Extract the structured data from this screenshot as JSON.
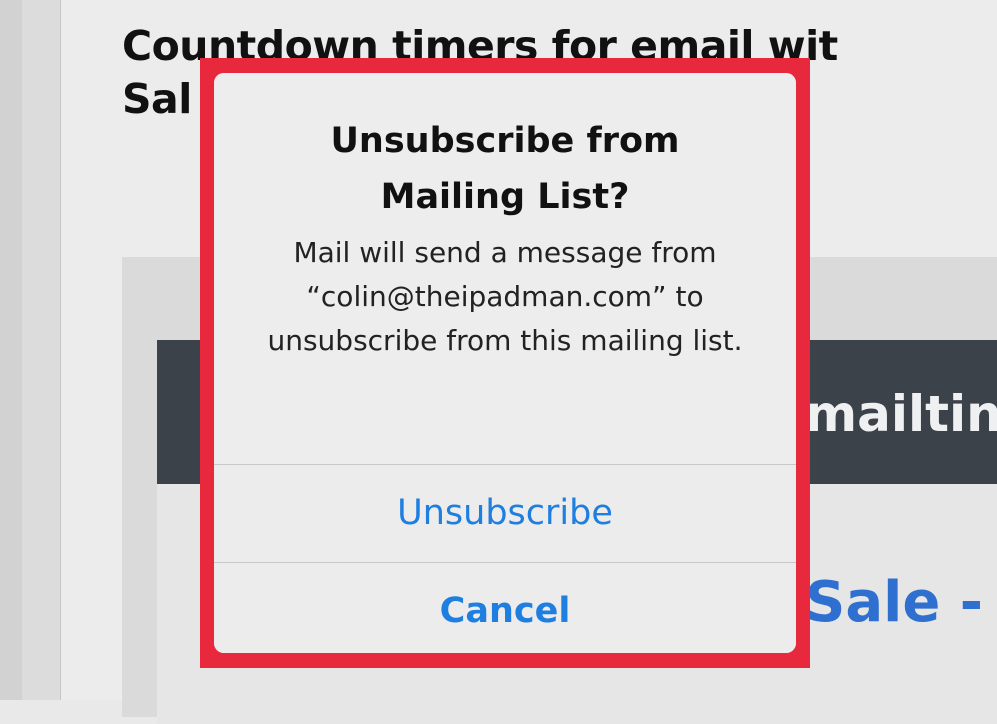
{
  "page": {
    "article_title": "Countdown timers for email wit\nSal"
  },
  "email_preview": {
    "header_text": "mailtin",
    "sale_text": "Sale - ",
    "sale_accent": "",
    "colors": {
      "header_bg": "#3c424a",
      "sale_blue": "#2f6fcf"
    }
  },
  "alert": {
    "title": "Unsubscribe from\nMailing List?",
    "message": "Mail will send a message from “colin@theipadman.com” to unsubscribe from this mailing list.",
    "unsubscribe_label": "Unsubscribe",
    "cancel_label": "Cancel",
    "colors": {
      "highlight_border": "#e8283d",
      "button_blue": "#1e7fe0"
    }
  }
}
